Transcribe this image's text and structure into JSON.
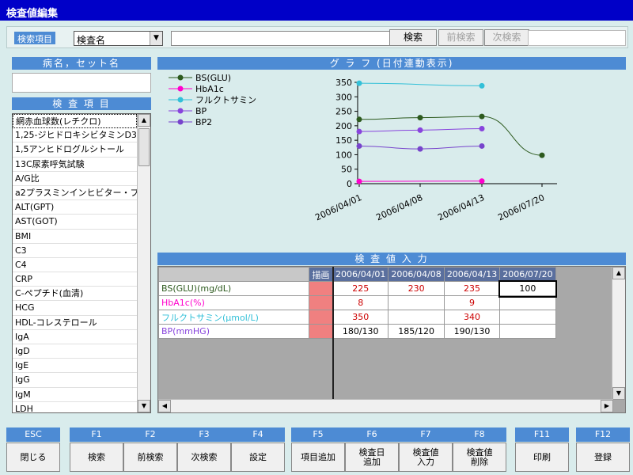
{
  "window_title": "検査値編集",
  "search": {
    "label": "検索項目",
    "select_value": "検査名",
    "input_value": "",
    "buttons": [
      "検索",
      "前検索",
      "次検索"
    ]
  },
  "disease_panel": {
    "header": "病名，セット名"
  },
  "items_panel": {
    "header": "検 査 項 目",
    "items": [
      "網赤血球数(レチクロ)",
      "1,25-ジヒドロキシビタミンD3",
      "1,5アンヒドログルシトール",
      "13C尿素呼気試験",
      "A/G比",
      "a2プラスミンインヒビター・プラスミ",
      "ALT(GPT)",
      "AST(GOT)",
      "BMI",
      "C3",
      "C4",
      "CRP",
      "C-ペプチド(血清)",
      "HCG",
      "HDL-コレステロール",
      "IgA",
      "IgD",
      "IgE",
      "IgG",
      "IgM",
      "LDH"
    ]
  },
  "graph_panel": {
    "header": "グ ラ フ (日付連動表示)"
  },
  "chart_data": {
    "type": "line",
    "categories": [
      "2006/04/01",
      "2006/04/08",
      "2006/04/13",
      "2006/07/20"
    ],
    "ylim": [
      0,
      350
    ],
    "yticks": [
      0,
      50,
      100,
      150,
      200,
      250,
      300,
      350
    ],
    "legend_placement": "top-left",
    "series": [
      {
        "name": "BS(GLU)",
        "color": "#2d5a1e",
        "values": [
          222,
          228,
          232,
          98
        ]
      },
      {
        "name": "HbA1c",
        "color": "#ff00cc",
        "values": [
          8,
          null,
          9,
          null
        ]
      },
      {
        "name": "フルクトサミン",
        "color": "#33c0d8",
        "values": [
          347,
          null,
          338,
          null
        ]
      },
      {
        "name": "BP",
        "color": "#8844dd",
        "values": [
          180,
          185,
          190,
          null
        ]
      },
      {
        "name": "BP2",
        "color": "#7744cc",
        "values": [
          130,
          120,
          130,
          null
        ]
      }
    ]
  },
  "input_panel": {
    "header": "検 査 値 入 力",
    "draw_header": "描画",
    "dates": [
      "2006/04/01",
      "2006/04/08",
      "2006/04/13",
      "2006/07/20"
    ],
    "rows": [
      {
        "name": "BS(GLU)(mg/dL)",
        "color": "#2d5a1e",
        "values": [
          "225",
          "230",
          "235",
          "100"
        ]
      },
      {
        "name": "HbA1c(%)",
        "color": "#ff00cc",
        "values": [
          "8",
          "",
          "9",
          ""
        ]
      },
      {
        "name": "フルクトサミン(μmol/L)",
        "color": "#33c0d8",
        "values": [
          "350",
          "",
          "340",
          ""
        ]
      },
      {
        "name": "BP(mmHG)",
        "color": "#8844dd",
        "values": [
          "180/130",
          "185/120",
          "190/130",
          ""
        ]
      }
    ],
    "value_color": "#cc0000"
  },
  "fkeys": [
    {
      "key": "ESC",
      "label": "閉じる"
    },
    {
      "key": "F1",
      "label": "検索"
    },
    {
      "key": "F2",
      "label": "前検索"
    },
    {
      "key": "F3",
      "label": "次検索"
    },
    {
      "key": "F4",
      "label": "設定"
    },
    {
      "key": "F5",
      "label": "項目追加"
    },
    {
      "key": "F6",
      "label": "検査日\n追加"
    },
    {
      "key": "F7",
      "label": "検査値\n入力"
    },
    {
      "key": "F8",
      "label": "検査値\n削除"
    },
    {
      "key": "F11",
      "label": "印刷"
    },
    {
      "key": "F12",
      "label": "登録"
    }
  ]
}
